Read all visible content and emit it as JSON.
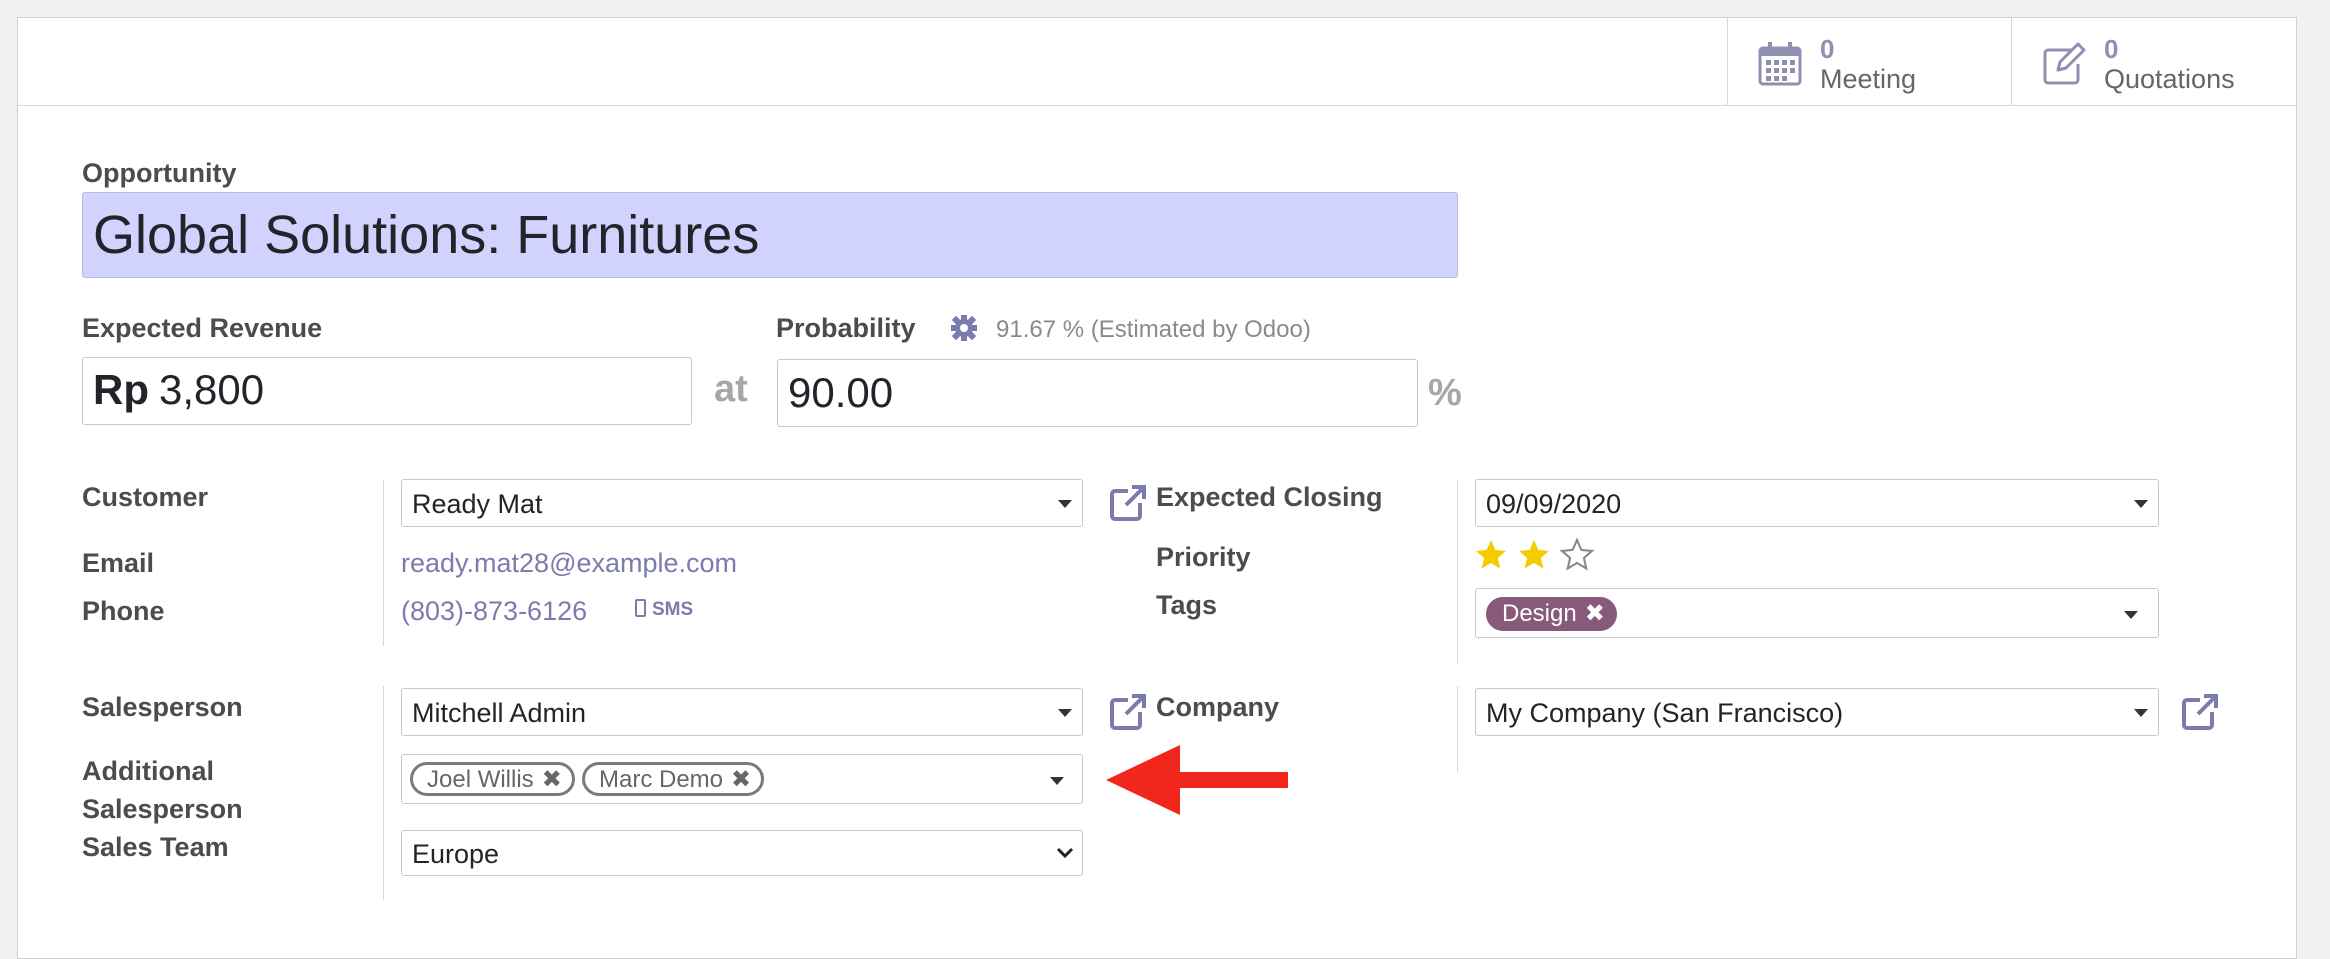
{
  "colors": {
    "accent": "#7c7bad",
    "title_field_bg": "#d2d2ff",
    "tag_design": "#875a7b",
    "arrow": "#f0271a",
    "star_filled": "#f3cc00"
  },
  "buttonbox": {
    "meeting": {
      "count": "0",
      "label": "Meeting",
      "icon": "calendar-icon"
    },
    "quotations": {
      "count": "0",
      "label": "Quotations",
      "icon": "edit-icon"
    }
  },
  "opportunity": {
    "label": "Opportunity",
    "name": "Global Solutions: Furnitures"
  },
  "revenue": {
    "label": "Expected Revenue",
    "currency": "Rp",
    "amount": "3,800",
    "at": "at"
  },
  "probability": {
    "label": "Probability",
    "estimated": "91.67 % (Estimated by Odoo)",
    "value": "90.00",
    "unit": "%"
  },
  "left": {
    "customer": {
      "label": "Customer",
      "value": "Ready Mat"
    },
    "email": {
      "label": "Email",
      "value": "ready.mat28@example.com"
    },
    "phone": {
      "label": "Phone",
      "value": "(803)-873-6126",
      "sms": "SMS"
    },
    "salesperson": {
      "label": "Salesperson",
      "value": "Mitchell Admin"
    },
    "additional": {
      "label_line1": "Additional",
      "label_line2": "Salesperson",
      "tags": [
        "Joel Willis",
        "Marc Demo"
      ]
    },
    "team": {
      "label": "Sales Team",
      "value": "Europe"
    }
  },
  "right": {
    "closing": {
      "label": "Expected Closing",
      "value": "09/09/2020"
    },
    "priority": {
      "label": "Priority",
      "stars_filled": 2,
      "stars_total": 3
    },
    "tags": {
      "label": "Tags",
      "items": [
        "Design"
      ]
    },
    "company": {
      "label": "Company",
      "value": "My Company (San Francisco)"
    }
  }
}
